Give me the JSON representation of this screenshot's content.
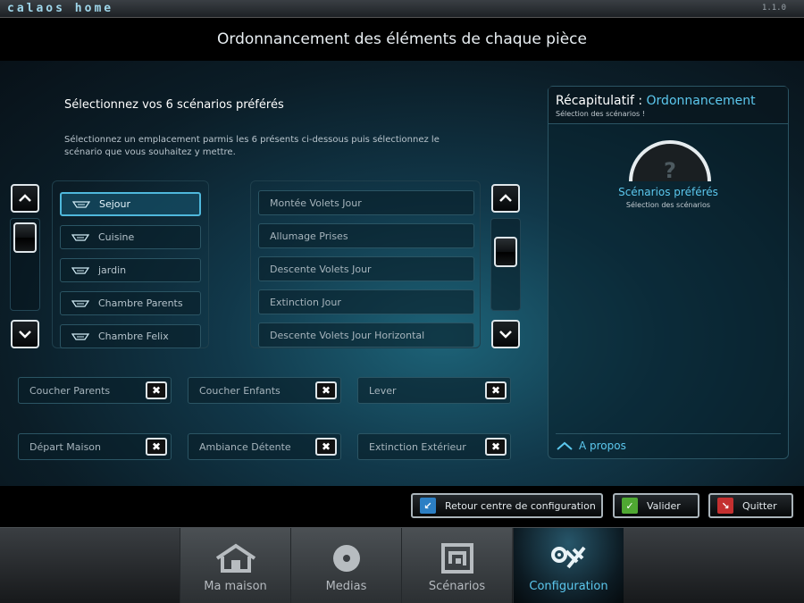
{
  "app": {
    "logo": "calaos home",
    "version": "1.1.0"
  },
  "page": {
    "title": "Ordonnancement des éléments de chaque pièce"
  },
  "main": {
    "heading": "Sélectionnez vos 6 scénarios préférés",
    "instructions": "Sélectionnez un emplacement parmis les 6 présents ci-dessous puis sélectionnez le scénario que vous souhaitez y mettre.",
    "rooms": [
      {
        "label": "Sejour",
        "selected": true
      },
      {
        "label": "Cuisine",
        "selected": false
      },
      {
        "label": "jardin",
        "selected": false
      },
      {
        "label": "Chambre Parents",
        "selected": false
      },
      {
        "label": "Chambre Felix",
        "selected": false
      }
    ],
    "scenarios": [
      "Montée Volets Jour",
      "Allumage Prises",
      "Descente Volets Jour",
      "Extinction Jour",
      "Descente Volets Jour Horizontal"
    ],
    "slots": [
      "Coucher Parents",
      "Coucher Enfants",
      "Lever",
      "Départ Maison",
      "Ambiance Détente",
      "Extinction Extérieur"
    ]
  },
  "recap": {
    "title_prefix": "Récapitulatif :",
    "title_highlight": "Ordonnancement",
    "subtitle": "Sélection des scénarios !",
    "gauge_glyph": "?",
    "label": "Scénarios préférés",
    "sublabel": "Sélection des scénarios",
    "about": "A propos"
  },
  "actions": {
    "back": "Retour centre de configuration",
    "validate": "Valider",
    "quit": "Quitter"
  },
  "nav": {
    "tabs": [
      {
        "label": "Ma maison",
        "icon": "house-icon"
      },
      {
        "label": "Medias",
        "icon": "disc-icon"
      },
      {
        "label": "Scénarios",
        "icon": "scenario-icon"
      },
      {
        "label": "Configuration",
        "icon": "configuration-icon",
        "active": true
      }
    ]
  },
  "colors": {
    "accent": "#5cc8ee",
    "selected_border": "#4fb8dc",
    "background": "#0b1d27"
  }
}
